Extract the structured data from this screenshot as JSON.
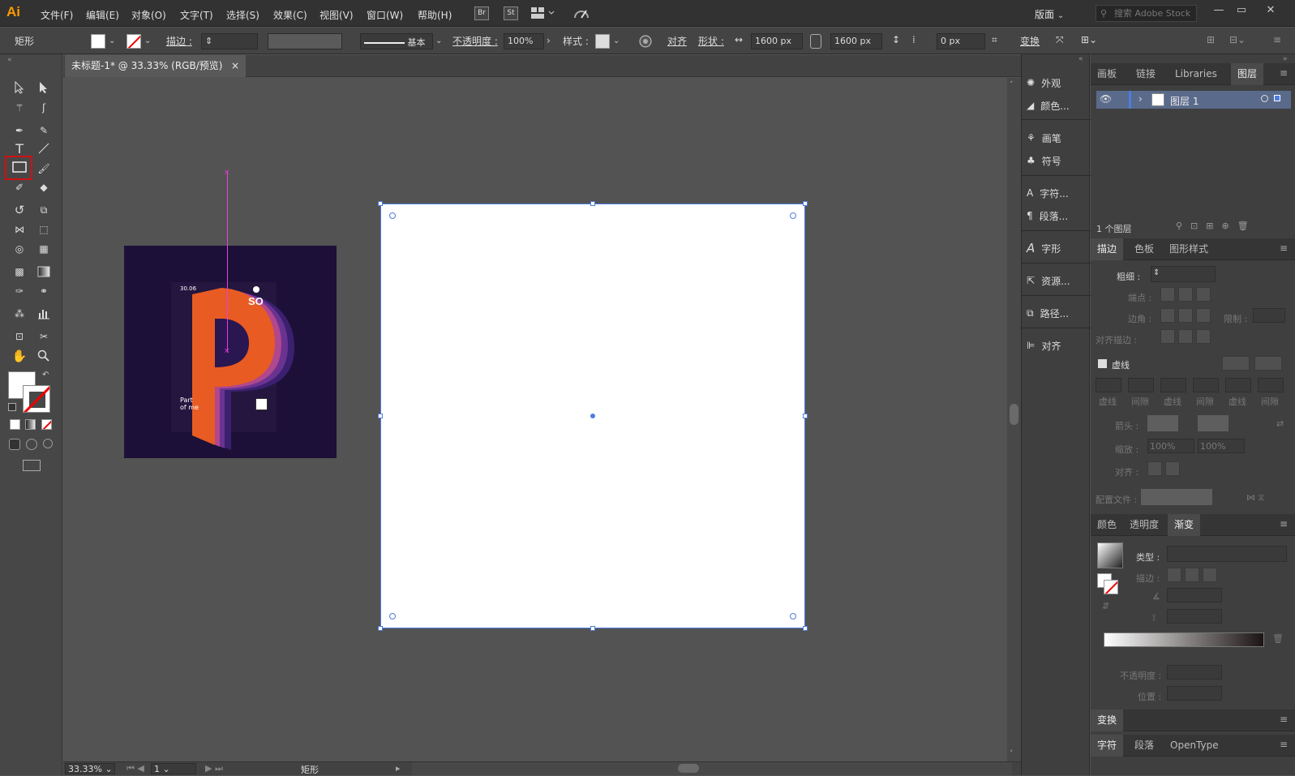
{
  "app": {
    "logo": "Ai"
  },
  "menu": [
    "文件(F)",
    "编辑(E)",
    "对象(O)",
    "文字(T)",
    "选择(S)",
    "效果(C)",
    "视图(V)",
    "窗口(W)",
    "帮助(H)"
  ],
  "bridge": {
    "br": "Br",
    "st": "St"
  },
  "workspace": "版面",
  "stock_placeholder": "搜索 Adobe Stock",
  "control": {
    "object_type": "矩形",
    "stroke_label": "描边 :",
    "brush_label": "基本",
    "opacity_label": "不透明度 :",
    "opacity_value": "100%",
    "style_label": "样式 :",
    "align_label": "对齐",
    "shape_label": "形状 :",
    "width_value": "1600 px",
    "height_value": "1600 px",
    "corner_value": "0 px",
    "transform_label": "变换"
  },
  "document": {
    "tab_title": "未标题-1* @ 33.33% (RGB/预览)",
    "close": "×"
  },
  "poster": {
    "date": "30.06",
    "brand": "SO",
    "caption1": "Part",
    "caption2": "of me",
    "bg": "#1d1038",
    "accent": "#e85b22"
  },
  "status": {
    "zoom": "33.33%",
    "page": "1",
    "tool": "矩形"
  },
  "dock": [
    "外观",
    "颜色...",
    "画笔",
    "符号",
    "字符...",
    "段落...",
    "字形",
    "资源...",
    "路径...",
    "对齐"
  ],
  "layers_panel": {
    "tabs": [
      "画板",
      "链接",
      "Libraries",
      "图层"
    ],
    "layer_name": "图层 1",
    "count": "1 个图层"
  },
  "stroke_panel": {
    "tabs": [
      "描边",
      "色板",
      "图形样式"
    ],
    "weight": "粗细 :",
    "cap": "端点 :",
    "corner": "边角 :",
    "limit": "限制 :",
    "align": "对齐描边 :",
    "dashed": "虚线",
    "dash_labels": [
      "虚线",
      "间隙",
      "虚线",
      "间隙",
      "虚线",
      "间隙"
    ],
    "arrow": "箭头 :",
    "scale": "缩放 :",
    "scale_v1": "100%",
    "scale_v2": "100%",
    "align2": "对齐 :",
    "profile": "配置文件 :"
  },
  "gradient_panel": {
    "tabs": [
      "颜色",
      "透明度",
      "渐变"
    ],
    "type": "类型 :",
    "stroke": "描边 :",
    "opacity": "不透明度 :",
    "position": "位置 :"
  },
  "collapsed": {
    "transform": "变换",
    "char_tabs": [
      "字符",
      "段落",
      "OpenType"
    ]
  }
}
